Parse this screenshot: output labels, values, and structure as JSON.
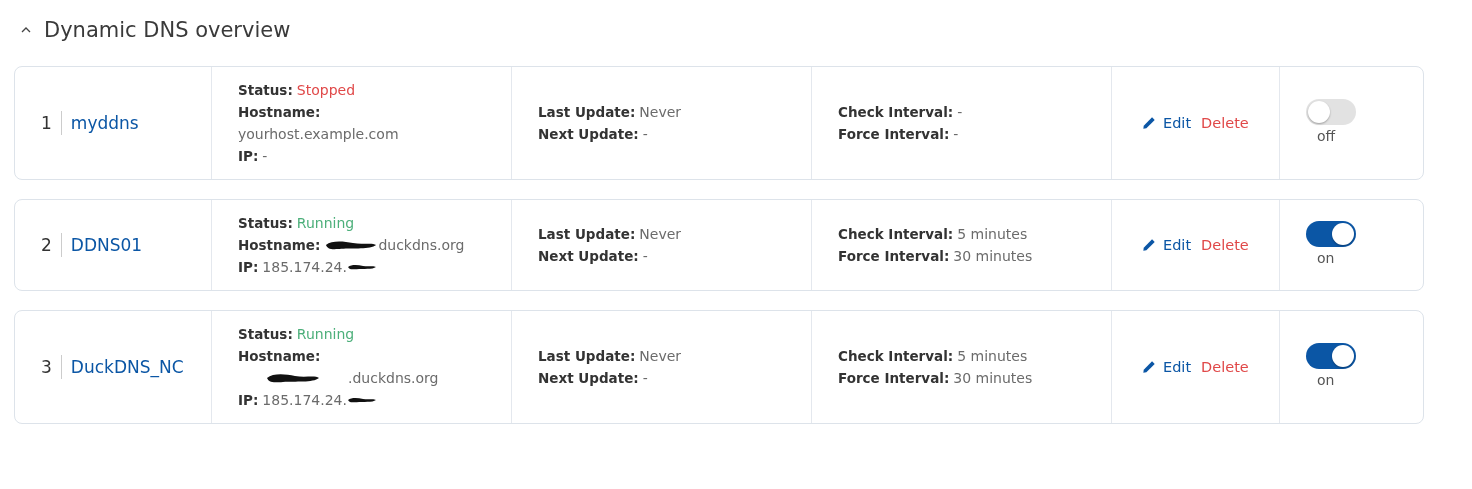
{
  "section": {
    "title": "Dynamic DNS overview",
    "expanded": true
  },
  "entries": [
    {
      "index": "1",
      "name": "myddns",
      "status_label": "Status:",
      "status": "Stopped",
      "running": false,
      "hostname_label": "Hostname:",
      "hostname": "yourhost.example.com",
      "hostname_wrapped": true,
      "hostname_redacted": false,
      "ip_label": "IP:",
      "ip": "-",
      "ip_redacted": false,
      "last_update_label": "Last Update:",
      "last_update": "Never",
      "next_update_label": "Next Update:",
      "next_update": "-",
      "check_interval_label": "Check Interval:",
      "check_interval": "-",
      "force_interval_label": "Force Interval:",
      "force_interval": "-",
      "edit": "Edit",
      "delete": "Delete",
      "on": false,
      "toggle_label": "off"
    },
    {
      "index": "2",
      "name": "DDNS01",
      "status_label": "Status:",
      "status": "Running",
      "running": true,
      "hostname_label": "Hostname:",
      "hostname": "duckdns.org",
      "hostname_wrapped": false,
      "hostname_redacted": true,
      "ip_label": "IP:",
      "ip": "185.174.24.",
      "ip_redacted": true,
      "last_update_label": "Last Update:",
      "last_update": "Never",
      "next_update_label": "Next Update:",
      "next_update": "-",
      "check_interval_label": "Check Interval:",
      "check_interval": "5 minutes",
      "force_interval_label": "Force Interval:",
      "force_interval": "30 minutes",
      "edit": "Edit",
      "delete": "Delete",
      "on": true,
      "toggle_label": "on"
    },
    {
      "index": "3",
      "name": "DuckDNS_NC",
      "status_label": "Status:",
      "status": "Running",
      "running": true,
      "hostname_label": "Hostname:",
      "hostname": ".duckdns.org",
      "hostname_wrapped": true,
      "hostname_redacted": true,
      "ip_label": "IP:",
      "ip": "185.174.24.",
      "ip_redacted": true,
      "last_update_label": "Last Update:",
      "last_update": "Never",
      "next_update_label": "Next Update:",
      "next_update": "-",
      "check_interval_label": "Check Interval:",
      "check_interval": "5 minutes",
      "force_interval_label": "Force Interval:",
      "force_interval": "30 minutes",
      "edit": "Edit",
      "delete": "Delete",
      "on": true,
      "toggle_label": "on"
    }
  ]
}
